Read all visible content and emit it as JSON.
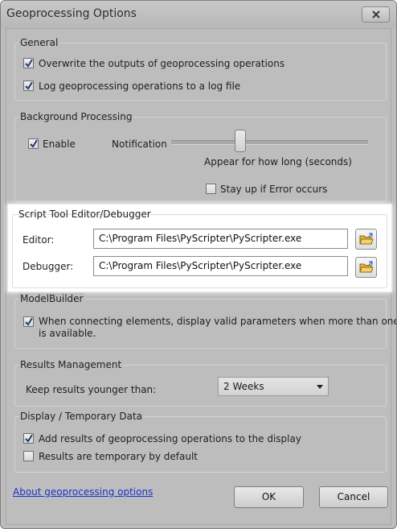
{
  "window": {
    "title": "Geoprocessing Options"
  },
  "general": {
    "label": "General",
    "overwrite": {
      "label": "Overwrite the outputs of geoprocessing operations",
      "checked": true
    },
    "log": {
      "label": "Log geoprocessing operations to a log file",
      "checked": true
    }
  },
  "background": {
    "label": "Background Processing",
    "enable": {
      "label": "Enable",
      "checked": true
    },
    "notification_label": "Notification",
    "appear_label": "Appear for how long (seconds)",
    "stay_up": {
      "label": "Stay up if Error occurs",
      "checked": false
    }
  },
  "script_tool": {
    "label": "Script Tool Editor/Debugger",
    "editor_label": "Editor:",
    "editor_value": "C:\\Program Files\\PyScripter\\PyScripter.exe",
    "debugger_label": "Debugger:",
    "debugger_value": "C:\\Program Files\\PyScripter\\PyScripter.exe"
  },
  "modelbuilder": {
    "label": "ModelBuilder",
    "valid_params": {
      "label_line1": "When connecting elements, display valid parameters when more than one",
      "label_line2": "is available.",
      "checked": true
    }
  },
  "results": {
    "label": "Results Management",
    "keep_label": "Keep results younger than:",
    "keep_value": "2 Weeks"
  },
  "display": {
    "label": "Display / Temporary Data",
    "add_results": {
      "label": "Add results of geoprocessing operations to the display",
      "checked": true
    },
    "temporary": {
      "label": "Results are temporary by default",
      "checked": false
    }
  },
  "footer": {
    "about_link": "About geoprocessing options",
    "ok_label": "OK",
    "cancel_label": "Cancel"
  }
}
